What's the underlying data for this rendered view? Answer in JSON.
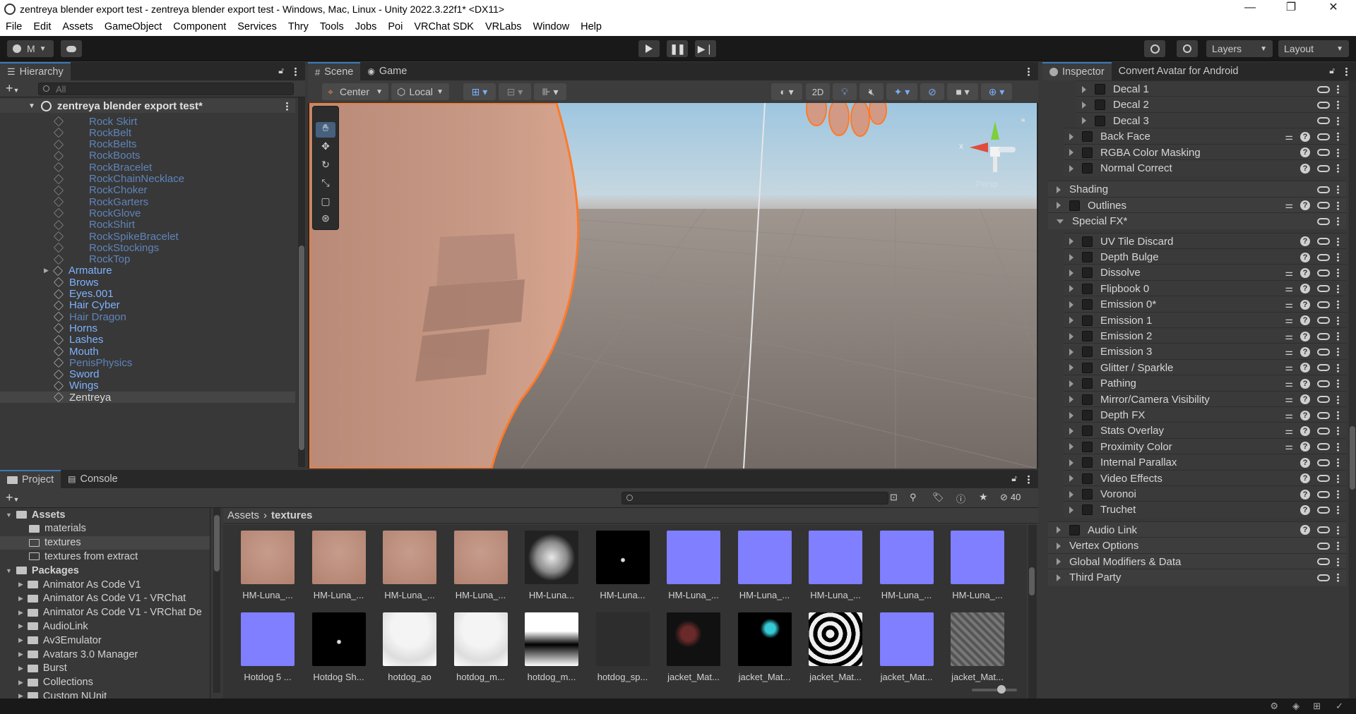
{
  "title": "zentreya blender export test - zentreya blender export test - Windows, Mac, Linux - Unity 2022.3.22f1* <DX11>",
  "menu": [
    "File",
    "Edit",
    "Assets",
    "GameObject",
    "Component",
    "Services",
    "Thry",
    "Tools",
    "Jobs",
    "Poi",
    "VRChat SDK",
    "VRLabs",
    "Window",
    "Help"
  ],
  "toolbar": {
    "account": "M",
    "layers": "Layers",
    "layout": "Layout"
  },
  "hierarchy": {
    "tab": "Hierarchy",
    "search_placeholder": "All",
    "scene": "zentreya blender export test*",
    "items": [
      {
        "label": "Rock Skirt",
        "style": "dim",
        "indent": 2
      },
      {
        "label": "RockBelt",
        "style": "dim",
        "indent": 2
      },
      {
        "label": "RockBelts",
        "style": "dim",
        "indent": 2
      },
      {
        "label": "RockBoots",
        "style": "dim",
        "indent": 2
      },
      {
        "label": "RockBracelet",
        "style": "dim",
        "indent": 2
      },
      {
        "label": "RockChainNecklace",
        "style": "dim",
        "indent": 2
      },
      {
        "label": "RockChoker",
        "style": "dim",
        "indent": 2
      },
      {
        "label": "RockGarters",
        "style": "dim",
        "indent": 2
      },
      {
        "label": "RockGlove",
        "style": "dim",
        "indent": 2
      },
      {
        "label": "RockShirt",
        "style": "dim",
        "indent": 2
      },
      {
        "label": "RockSpikeBracelet",
        "style": "dim",
        "indent": 2
      },
      {
        "label": "RockStockings",
        "style": "dim",
        "indent": 2
      },
      {
        "label": "RockTop",
        "style": "dim",
        "indent": 2
      },
      {
        "label": "Armature",
        "style": "blue",
        "indent": 1,
        "fold": true
      },
      {
        "label": "Brows",
        "style": "blue",
        "indent": 1
      },
      {
        "label": "Eyes.001",
        "style": "blue",
        "indent": 1
      },
      {
        "label": "Hair Cyber",
        "style": "blue",
        "indent": 1
      },
      {
        "label": "Hair Dragon",
        "style": "dim",
        "indent": 1
      },
      {
        "label": "Horns",
        "style": "blue",
        "indent": 1
      },
      {
        "label": "Lashes",
        "style": "blue",
        "indent": 1
      },
      {
        "label": "Mouth",
        "style": "blue",
        "indent": 1
      },
      {
        "label": "PenisPhysics",
        "style": "dim",
        "indent": 1
      },
      {
        "label": "Sword",
        "style": "blue",
        "indent": 1
      },
      {
        "label": "Wings",
        "style": "blue",
        "indent": 1
      },
      {
        "label": "Zentreya",
        "style": "white",
        "indent": 1
      }
    ]
  },
  "scene_view": {
    "tab_scene": "Scene",
    "tab_game": "Game",
    "pivot": "Center",
    "space": "Local",
    "mode2d": "2D",
    "axis_x": "x",
    "axis_label": "Persp"
  },
  "inspector": {
    "tab": "Inspector",
    "tab2": "Convert Avatar for Android",
    "rows": [
      {
        "label": "Decal 1",
        "level": 2,
        "chk": true,
        "icons": "l"
      },
      {
        "label": "Decal 2",
        "level": 2,
        "chk": true,
        "icons": "l"
      },
      {
        "label": "Decal 3",
        "level": 2,
        "chk": true,
        "icons": "l"
      },
      {
        "label": "Back Face",
        "level": 1,
        "chk": true,
        "icons": "shl"
      },
      {
        "label": "RGBA Color Masking",
        "level": 1,
        "chk": true,
        "icons": "hl"
      },
      {
        "label": "Normal Correct",
        "level": 1,
        "chk": true,
        "icons": "hl"
      },
      {
        "label": "Shading",
        "level": 0,
        "chk": false,
        "icons": "l"
      },
      {
        "label": "Outlines",
        "level": 0,
        "chk": true,
        "icons": "shl"
      },
      {
        "label": "Special FX*",
        "level": 0,
        "chk": false,
        "open": true,
        "icons": "l"
      },
      {
        "label": "UV Tile Discard",
        "level": 1,
        "chk": true,
        "icons": "hl"
      },
      {
        "label": "Depth Bulge",
        "level": 1,
        "chk": true,
        "icons": "hl"
      },
      {
        "label": "Dissolve",
        "level": 1,
        "chk": true,
        "icons": "shl"
      },
      {
        "label": "Flipbook 0",
        "level": 1,
        "chk": true,
        "icons": "shl"
      },
      {
        "label": "Emission 0*",
        "level": 1,
        "chk": true,
        "icons": "shl"
      },
      {
        "label": "Emission 1",
        "level": 1,
        "chk": true,
        "icons": "shl"
      },
      {
        "label": "Emission 2",
        "level": 1,
        "chk": true,
        "icons": "shl"
      },
      {
        "label": "Emission 3",
        "level": 1,
        "chk": true,
        "icons": "shl"
      },
      {
        "label": "Glitter / Sparkle",
        "level": 1,
        "chk": true,
        "icons": "shl"
      },
      {
        "label": "Pathing",
        "level": 1,
        "chk": true,
        "icons": "shl"
      },
      {
        "label": "Mirror/Camera Visibility",
        "level": 1,
        "chk": true,
        "icons": "shl"
      },
      {
        "label": "Depth FX",
        "level": 1,
        "chk": true,
        "icons": "shl"
      },
      {
        "label": "Stats Overlay",
        "level": 1,
        "chk": true,
        "icons": "shl"
      },
      {
        "label": "Proximity Color",
        "level": 1,
        "chk": true,
        "icons": "shl"
      },
      {
        "label": "Internal Parallax",
        "level": 1,
        "chk": true,
        "icons": "hl"
      },
      {
        "label": "Video Effects",
        "level": 1,
        "chk": true,
        "icons": "hl"
      },
      {
        "label": "Voronoi",
        "level": 1,
        "chk": true,
        "icons": "hl"
      },
      {
        "label": "Truchet",
        "level": 1,
        "chk": true,
        "icons": "hl"
      },
      {
        "label": "Audio Link",
        "level": 0,
        "chk": true,
        "icons": "hl"
      },
      {
        "label": "Vertex Options",
        "level": 0,
        "chk": false,
        "icons": "l"
      },
      {
        "label": "Global Modifiers & Data",
        "level": 0,
        "chk": false,
        "icons": "l"
      },
      {
        "label": "Third Party",
        "level": 0,
        "chk": false,
        "icons": "l"
      }
    ]
  },
  "project": {
    "tab": "Project",
    "tab2": "Console",
    "hidden_count": "40",
    "breadcrumb": [
      "Assets",
      "textures"
    ],
    "tree": [
      {
        "label": "Assets",
        "level": 0,
        "bold": true,
        "open": true
      },
      {
        "label": "materials",
        "level": 1
      },
      {
        "label": "textures",
        "level": 1,
        "selected": true
      },
      {
        "label": "textures from extract",
        "level": 1
      },
      {
        "label": "Packages",
        "level": 0,
        "bold": true,
        "open": true
      },
      {
        "label": "Animator As Code V1",
        "level": 1
      },
      {
        "label": "Animator As Code V1 - VRChat",
        "level": 1
      },
      {
        "label": "Animator As Code V1 - VRChat De",
        "level": 1
      },
      {
        "label": "AudioLink",
        "level": 1
      },
      {
        "label": "Av3Emulator",
        "level": 1
      },
      {
        "label": "Avatars 3.0 Manager",
        "level": 1
      },
      {
        "label": "Burst",
        "level": 1
      },
      {
        "label": "Collections",
        "level": 1
      },
      {
        "label": "Custom NUnit",
        "level": 1
      }
    ],
    "assets": [
      {
        "label": "HM-Luna_...",
        "kind": "skin"
      },
      {
        "label": "HM-Luna_...",
        "kind": "skin"
      },
      {
        "label": "HM-Luna_...",
        "kind": "skin"
      },
      {
        "label": "HM-Luna_...",
        "kind": "skin"
      },
      {
        "label": "HM-Luna...",
        "kind": "face"
      },
      {
        "label": "HM-Luna...",
        "kind": "black"
      },
      {
        "label": "HM-Luna_...",
        "kind": "normal"
      },
      {
        "label": "HM-Luna_...",
        "kind": "normal"
      },
      {
        "label": "HM-Luna_...",
        "kind": "normal"
      },
      {
        "label": "HM-Luna_...",
        "kind": "normal"
      },
      {
        "label": "HM-Luna_...",
        "kind": "normal"
      },
      {
        "label": "Hotdog 5 ...",
        "kind": "normal"
      },
      {
        "label": "Hotdog Sh...",
        "kind": "black"
      },
      {
        "label": "hotdog_ao",
        "kind": "white"
      },
      {
        "label": "hotdog_m...",
        "kind": "white"
      },
      {
        "label": "hotdog_m...",
        "kind": "grad"
      },
      {
        "label": "hotdog_sp...",
        "kind": "dark"
      },
      {
        "label": "jacket_Mat...",
        "kind": "red"
      },
      {
        "label": "jacket_Mat...",
        "kind": "cyan"
      },
      {
        "label": "jacket_Mat...",
        "kind": "bw"
      },
      {
        "label": "jacket_Mat...",
        "kind": "normal"
      },
      {
        "label": "jacket_Mat...",
        "kind": "gray"
      }
    ]
  }
}
